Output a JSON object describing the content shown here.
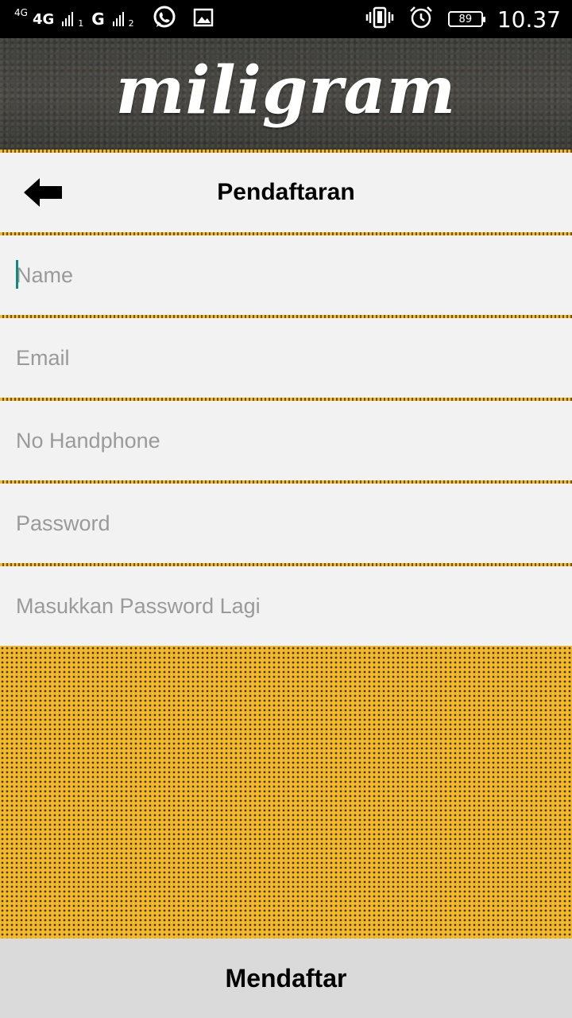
{
  "status_bar": {
    "network_small": "4G",
    "network": "4G",
    "sim1_sub": "1",
    "network_g": "G",
    "sim2_sub": "2",
    "battery": "89",
    "time": "10.37",
    "icons": [
      "whatsapp-icon",
      "image-icon",
      "vibrate-icon",
      "alarm-icon"
    ]
  },
  "header": {
    "logo_text": "miligram"
  },
  "titlebar": {
    "title": "Pendaftaran",
    "back_icon": "arrow-left-icon"
  },
  "form": {
    "name_placeholder": "Name",
    "email_placeholder": "Email",
    "phone_placeholder": "No Handphone",
    "password_placeholder": "Password",
    "password_confirm_placeholder": "Masukkan Password Lagi"
  },
  "submit_label": "Mendaftar",
  "colors": {
    "accent_yellow": "#f3b92a",
    "header_dark": "#444440",
    "caret": "#0e8a7e"
  }
}
